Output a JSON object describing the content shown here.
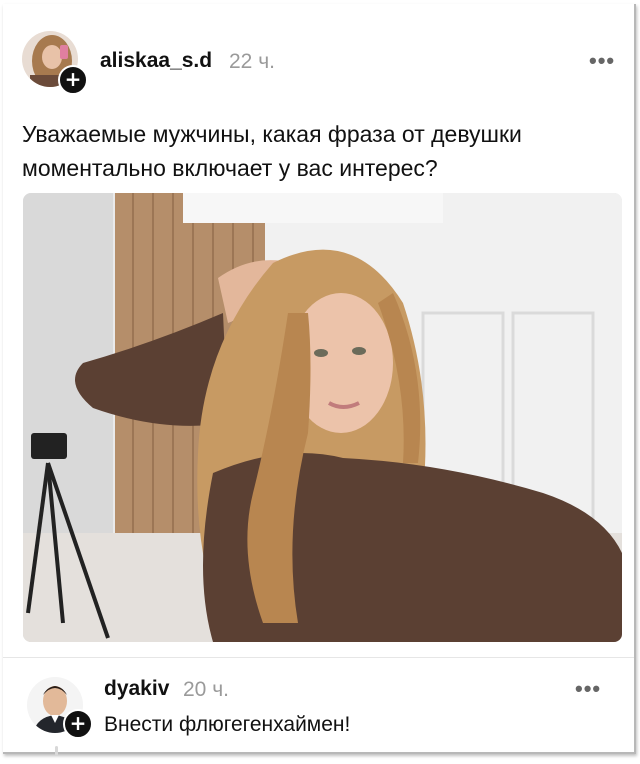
{
  "post": {
    "username": "aliskaa_s.d",
    "time": "22 ч.",
    "more": "•••",
    "text": "Уважаемые мужчины, какая фраза от девушки моментально включает у вас интерес?",
    "follow_glyph": "+"
  },
  "reply": {
    "username": "dyakiv",
    "time": "20 ч.",
    "more": "•••",
    "text": "Внести флюгегенхаймен!",
    "follow_glyph": "+"
  },
  "colors": {
    "text": "#111111",
    "muted": "#9a9a9a",
    "badge": "#111111",
    "sweater": "#5b4033",
    "hair": "#c79a63"
  }
}
